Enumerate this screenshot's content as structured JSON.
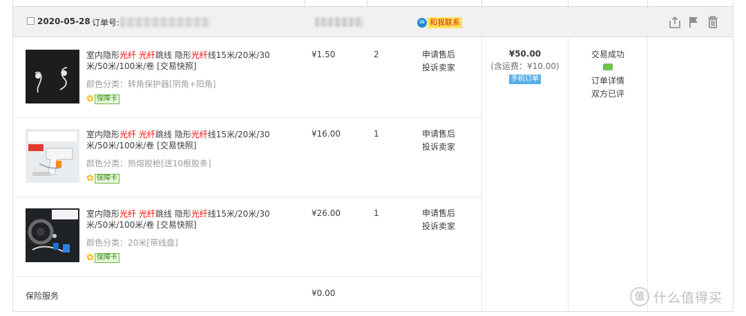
{
  "header": {
    "date": "2020-05-28",
    "order_label": "订单号:",
    "contact_label": "和我联系",
    "icons": [
      "share-icon",
      "flag-icon",
      "trash-icon"
    ]
  },
  "items": [
    {
      "title_parts": [
        "室内隐形",
        "光纤",
        " ",
        "光纤",
        "跳线 隐形",
        "光纤",
        "线15米/20米/30米/50米/100米/卷 [交易快照]"
      ],
      "sku": "颜色分类：转角保护器[阴角+阳角]",
      "badge": "保障卡",
      "price": "¥1.50",
      "qty": "2",
      "action1": "申请售后",
      "action2": "投诉卖家"
    },
    {
      "title_parts": [
        "室内隐形",
        "光纤",
        " ",
        "光纤",
        "跳线 隐形",
        "光纤",
        "线15米/20米/30米/50米/100米/卷 [交易快照]"
      ],
      "sku": "颜色分类：热熔胶枪[送10根胶条]",
      "badge": "保障卡",
      "price": "¥16.00",
      "qty": "1",
      "action1": "申请售后",
      "action2": "投诉卖家"
    },
    {
      "title_parts": [
        "室内隐形",
        "光纤",
        " ",
        "光纤",
        "跳线 隐形",
        "光纤",
        "线15米/20米/30米/50米/100米/卷 [交易快照]"
      ],
      "sku": "颜色分类：20米[带线盘]",
      "badge": "保障卡",
      "price": "¥26.00",
      "qty": "1",
      "action1": "申请售后",
      "action2": "投诉卖家"
    }
  ],
  "total": {
    "amount": "¥50.00",
    "shipping": "(含运费：¥10.00)",
    "mobile_badge": "手机订单"
  },
  "status": {
    "state": "交易成功",
    "detail": "订单详情",
    "review": "双方已评"
  },
  "insurance": {
    "label": "保险服务",
    "price": "¥0.00"
  },
  "watermark": {
    "symbol": "值",
    "text": "什么值得买"
  },
  "colors": {
    "highlight": "#ff0000",
    "header_bg": "#f1f1f1",
    "contact_bg": "#ffe25a",
    "contact_text": "#d12b00",
    "mobile_badge_bg": "#5aaee6",
    "guarantee_green": "#2e8b12"
  }
}
